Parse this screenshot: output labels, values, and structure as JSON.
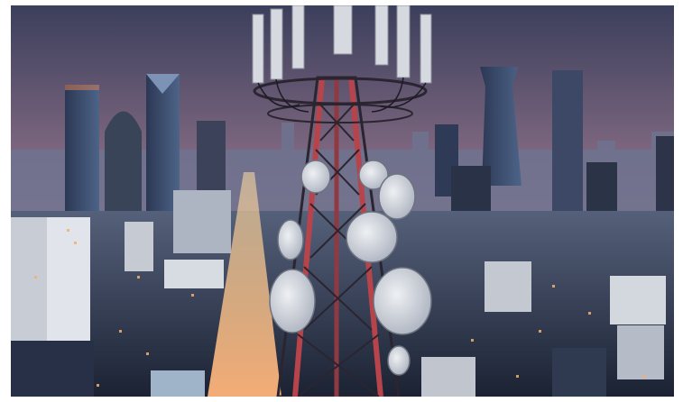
{
  "image": {
    "subject": "telecom-tower-at-dusk-over-city",
    "colors": {
      "sky_top": "#3b3f5c",
      "sky_mid": "#8a6e86",
      "sky_horizon": "#e79a8f",
      "haze": "#6b6f88",
      "building_dark": "#1f2638",
      "building_mid": "#3a4560",
      "tower_red": "#b8444b",
      "tower_dark": "#2a2530",
      "dish": "#d9dde3",
      "road_light": "#f4c48b",
      "window_glow": "#f2b26a"
    }
  }
}
